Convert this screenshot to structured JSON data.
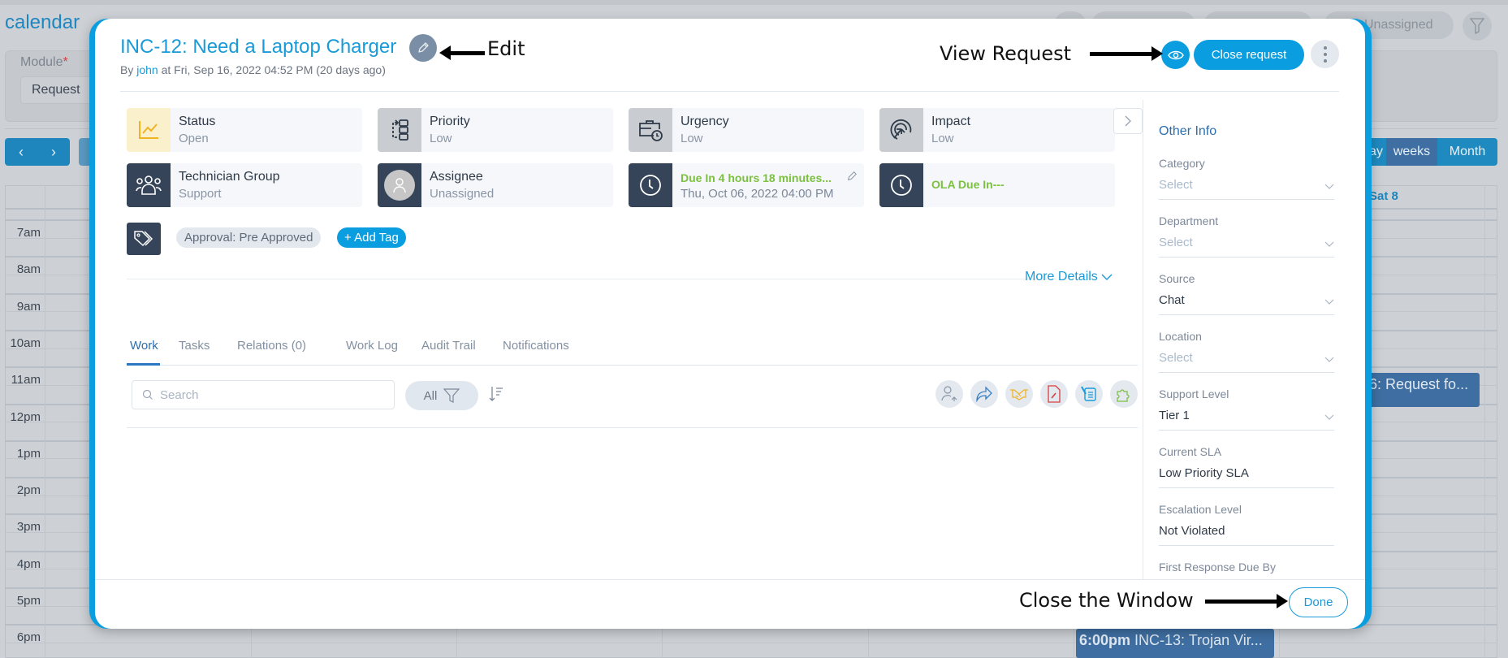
{
  "background": {
    "app_title": "calendar",
    "filter_pill_text": "Unassigned",
    "module_label": "Module",
    "module_required_mark": "*",
    "module_value": "Request",
    "nav_prev": "‹",
    "nav_next": "›",
    "views": [
      "ay",
      "weeks",
      "Month"
    ],
    "day_header": "Sat 8",
    "hours": [
      "7am",
      "8am",
      "9am",
      "10am",
      "11am",
      "12pm",
      "1pm",
      "2pm",
      "3pm",
      "4pm",
      "5pm",
      "6pm"
    ],
    "events": [
      {
        "time": "",
        "title": "6: Request fo..."
      },
      {
        "time": "6:00pm",
        "title": "INC-13: Trojan Vir..."
      }
    ]
  },
  "modal": {
    "title": "INC-12: Need a Laptop Charger",
    "subtitle_prefix": "By",
    "subtitle_user": "john",
    "subtitle_rest": "at Fri, Sep 16, 2022 04:52 PM (20 days ago)",
    "close_request_label": "Close request",
    "cards": [
      {
        "icon": "trend-chart-icon",
        "title": "Status",
        "value": "Open"
      },
      {
        "icon": "priority-flow-icon",
        "title": "Priority",
        "value": "Low"
      },
      {
        "icon": "briefcase-clock-icon",
        "title": "Urgency",
        "value": "Low"
      },
      {
        "icon": "target-icon",
        "title": "Impact",
        "value": "Low"
      },
      {
        "icon": "group-icon",
        "title": "Technician Group",
        "value": "Support"
      },
      {
        "icon": "user-avatar-icon",
        "title": "Assignee",
        "value": "Unassigned"
      },
      {
        "icon": "clock-icon",
        "title": "Due In 4 hours 18 minutes...",
        "value": "Thu, Oct 06, 2022 04:00 PM"
      },
      {
        "icon": "clock-icon",
        "title": "OLA Due In---",
        "value": ""
      }
    ],
    "tags": [
      "Approval: Pre Approved"
    ],
    "add_tag_label": "+ Add Tag",
    "more_details_label": "More Details",
    "tabs": [
      "Work",
      "Tasks",
      "Relations (0)",
      "Work Log",
      "Audit Trail",
      "Notifications"
    ],
    "active_tab": "Work",
    "search_placeholder": "Search",
    "filter_label": "All",
    "action_icons": [
      "assign-user-icon",
      "forward-icon",
      "handshake-icon",
      "pdf-icon",
      "notes-icon",
      "plugin-icon"
    ],
    "side_panel": {
      "title": "Other Info",
      "fields": [
        {
          "label": "Category",
          "value": "Select",
          "placeholder": true,
          "dropdown": true
        },
        {
          "label": "Department",
          "value": "Select",
          "placeholder": true,
          "dropdown": true
        },
        {
          "label": "Source",
          "value": "Chat",
          "placeholder": false,
          "dropdown": true
        },
        {
          "label": "Location",
          "value": "Select",
          "placeholder": true,
          "dropdown": true
        },
        {
          "label": "Support Level",
          "value": "Tier 1",
          "placeholder": false,
          "dropdown": true
        },
        {
          "label": "Current SLA",
          "value": "Low Priority SLA",
          "placeholder": false,
          "dropdown": false
        },
        {
          "label": "Escalation Level",
          "value": "Not Violated",
          "placeholder": false,
          "dropdown": false
        },
        {
          "label": "First Response Due By",
          "value": "",
          "placeholder": false,
          "dropdown": false
        }
      ]
    },
    "done_label": "Done"
  },
  "annotations": {
    "edit": "Edit",
    "view_request": "View Request",
    "close_window": "Close the Window"
  },
  "colors": {
    "accent": "#0a9ee0",
    "title": "#1a9ad6",
    "due_green": "#7cc040",
    "icon_dark": "#354458"
  }
}
